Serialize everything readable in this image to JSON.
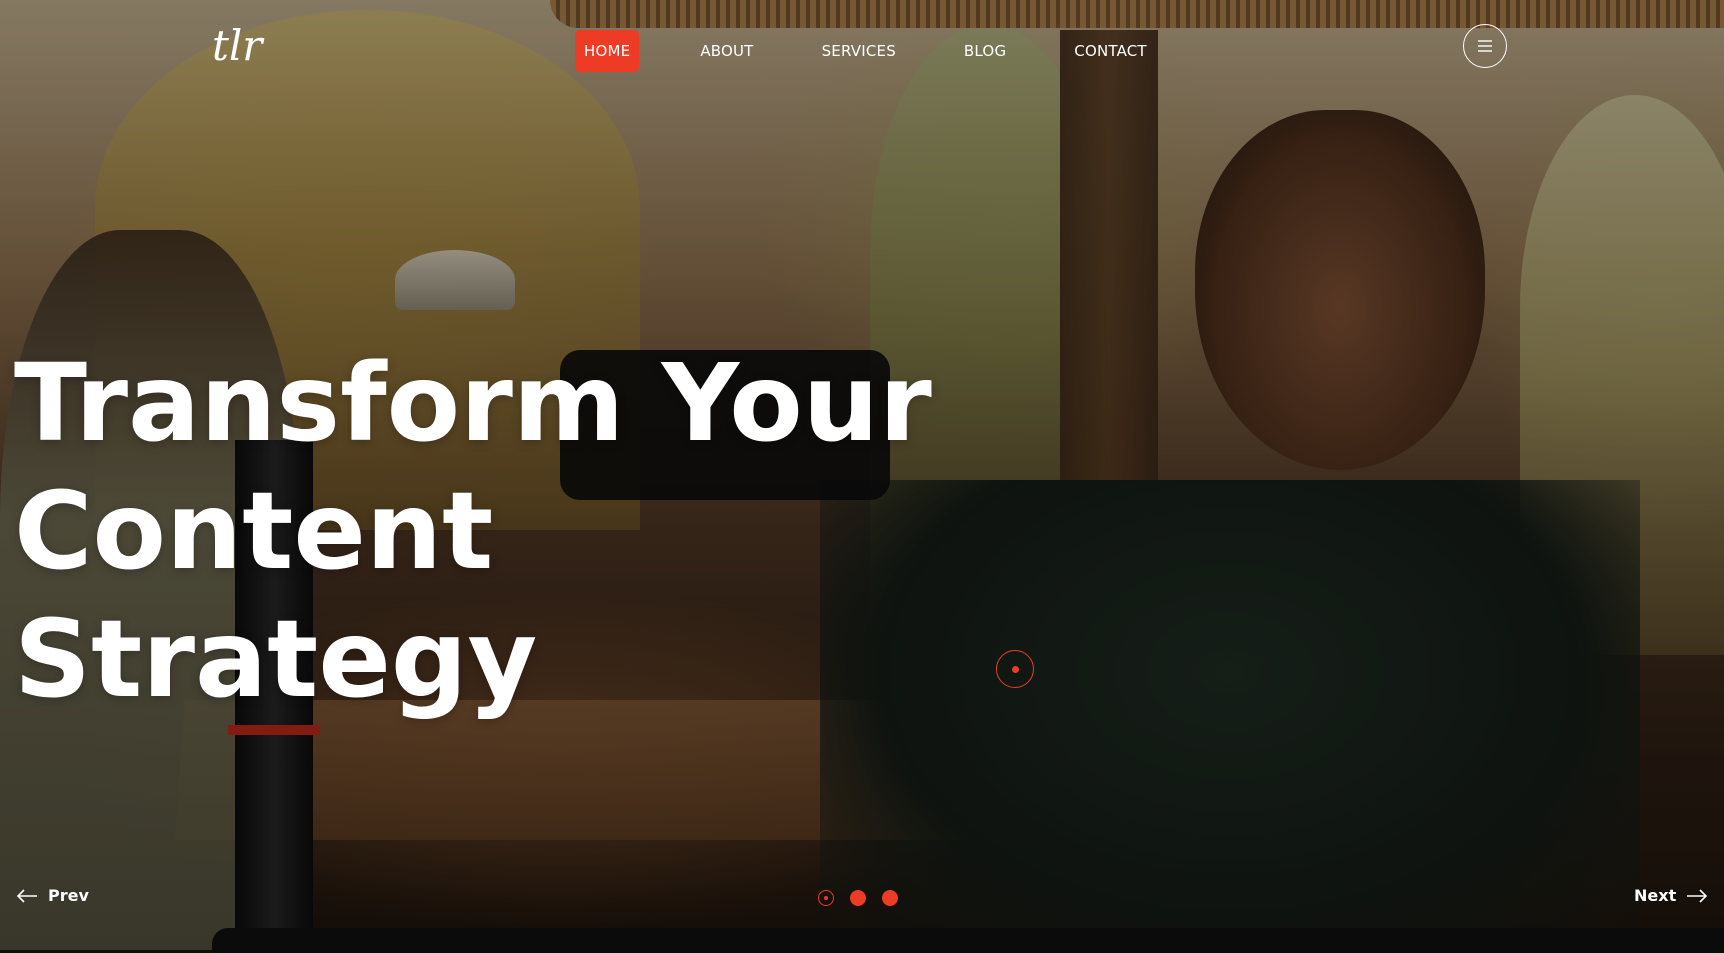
{
  "brand": {
    "logo_text": "tlr"
  },
  "nav": {
    "items": [
      {
        "label": "HOME",
        "active": true
      },
      {
        "label": "ABOUT",
        "active": false
      },
      {
        "label": "SERVICES",
        "active": false
      },
      {
        "label": "BLOG",
        "active": false
      },
      {
        "label": "CONTACT",
        "active": false
      }
    ],
    "menu_icon": "hamburger-icon"
  },
  "hero": {
    "headline_line1": "Transform Your Content",
    "headline_line2": "Strategy",
    "prev_label": "Prev",
    "next_label": "Next",
    "slides": {
      "count": 3,
      "active_index": 0
    }
  },
  "colors": {
    "accent": "#ee3b26",
    "text": "#ffffff",
    "bottom_bar": "#0b0b0b"
  }
}
